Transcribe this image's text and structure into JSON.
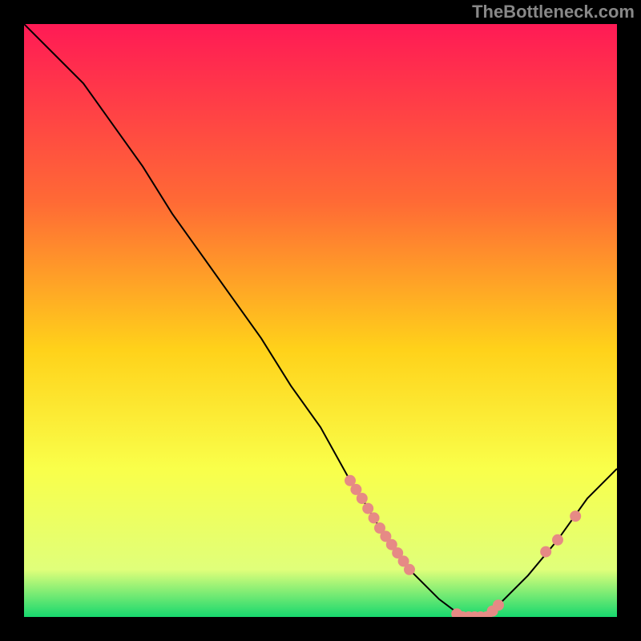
{
  "watermark": "TheBottleneck.com",
  "chart_data": {
    "type": "line",
    "title": "",
    "xlabel": "",
    "ylabel": "",
    "xlim": [
      0,
      100
    ],
    "ylim": [
      0,
      100
    ],
    "series": [
      {
        "name": "curve",
        "x": [
          0,
          5,
          10,
          15,
          20,
          25,
          30,
          35,
          40,
          45,
          50,
          55,
          57,
          60,
          65,
          70,
          74,
          78,
          80,
          85,
          90,
          95,
          100
        ],
        "y": [
          100,
          95,
          90,
          83,
          76,
          68,
          61,
          54,
          47,
          39,
          32,
          23,
          20,
          15,
          8,
          3,
          0,
          0,
          2,
          7,
          13,
          20,
          25
        ]
      }
    ],
    "markers": [
      {
        "name": "cluster1",
        "x": [
          55,
          56,
          57,
          58,
          59,
          60,
          61,
          62,
          63,
          64,
          65
        ],
        "y": [
          23,
          21.5,
          20,
          18.3,
          16.7,
          15,
          13.6,
          12.2,
          10.8,
          9.4,
          8
        ]
      },
      {
        "name": "cluster2",
        "x": [
          73,
          74,
          75,
          76,
          77,
          78,
          79,
          80
        ],
        "y": [
          0.5,
          0,
          0,
          0,
          0,
          0,
          1,
          2
        ]
      },
      {
        "name": "cluster3",
        "x": [
          88,
          90,
          93
        ],
        "y": [
          11,
          13,
          17
        ]
      }
    ],
    "gradient_stops": [
      {
        "offset": 0,
        "color": "#ff1a55"
      },
      {
        "offset": 30,
        "color": "#ff6a35"
      },
      {
        "offset": 55,
        "color": "#ffd21a"
      },
      {
        "offset": 75,
        "color": "#f9ff4a"
      },
      {
        "offset": 92,
        "color": "#e0ff7a"
      },
      {
        "offset": 100,
        "color": "#17d86e"
      }
    ],
    "marker_color": "#e68a85",
    "line_color": "#000000"
  }
}
